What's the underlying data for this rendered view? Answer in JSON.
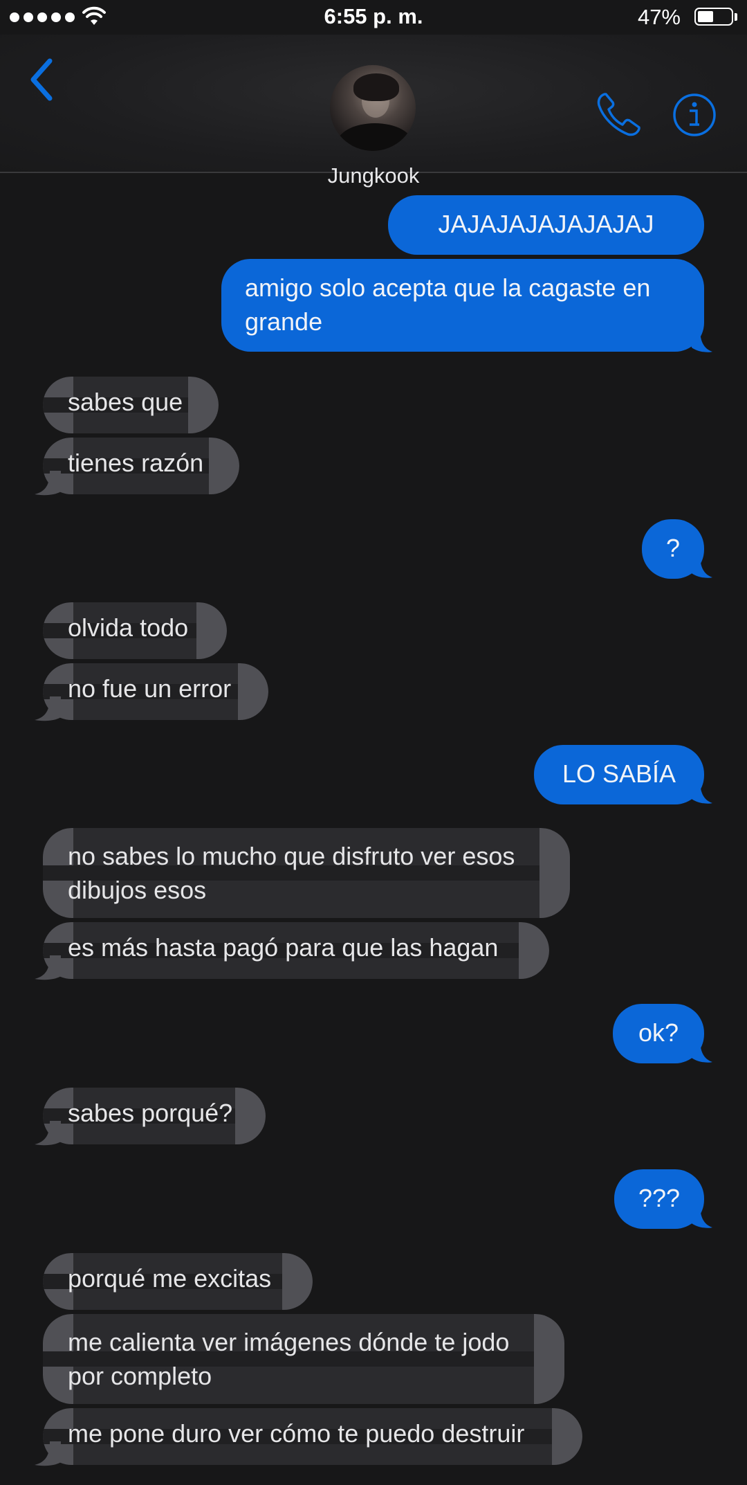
{
  "status_bar": {
    "time": "6:55 p. m.",
    "battery": "47%"
  },
  "header": {
    "contact_name": "Jungkook"
  },
  "messages": [
    {
      "from": "me",
      "text": "JAJAJAJAJAJAJAJ"
    },
    {
      "from": "me",
      "text": "amigo solo acepta que la cagaste en grande"
    },
    {
      "from": "them",
      "text": "sabes que"
    },
    {
      "from": "them",
      "text": "tienes razón"
    },
    {
      "from": "me",
      "text": "?"
    },
    {
      "from": "them",
      "text": "olvida todo"
    },
    {
      "from": "them",
      "text": "no fue un error"
    },
    {
      "from": "me",
      "text": "LO SABÍA"
    },
    {
      "from": "them",
      "text": "no sabes lo mucho que disfruto ver esos dibujos esos"
    },
    {
      "from": "them",
      "text": "es más hasta pagó para que las hagan"
    },
    {
      "from": "me",
      "text": "ok?"
    },
    {
      "from": "them",
      "text": "sabes porqué?"
    },
    {
      "from": "me",
      "text": "???"
    },
    {
      "from": "them",
      "text": "porqué me excitas"
    },
    {
      "from": "them",
      "text": "me calienta ver imágenes dónde te jodo por completo"
    },
    {
      "from": "them",
      "text": "me pone duro ver cómo te puedo destruir"
    }
  ],
  "colors": {
    "outgoing": "#0b67d8",
    "incoming": "#2b2b2e",
    "accent": "#0a6fe0",
    "background": "#171718"
  },
  "icons": [
    "back-chevron-icon",
    "phone-icon",
    "info-icon",
    "wifi-icon",
    "battery-icon"
  ]
}
